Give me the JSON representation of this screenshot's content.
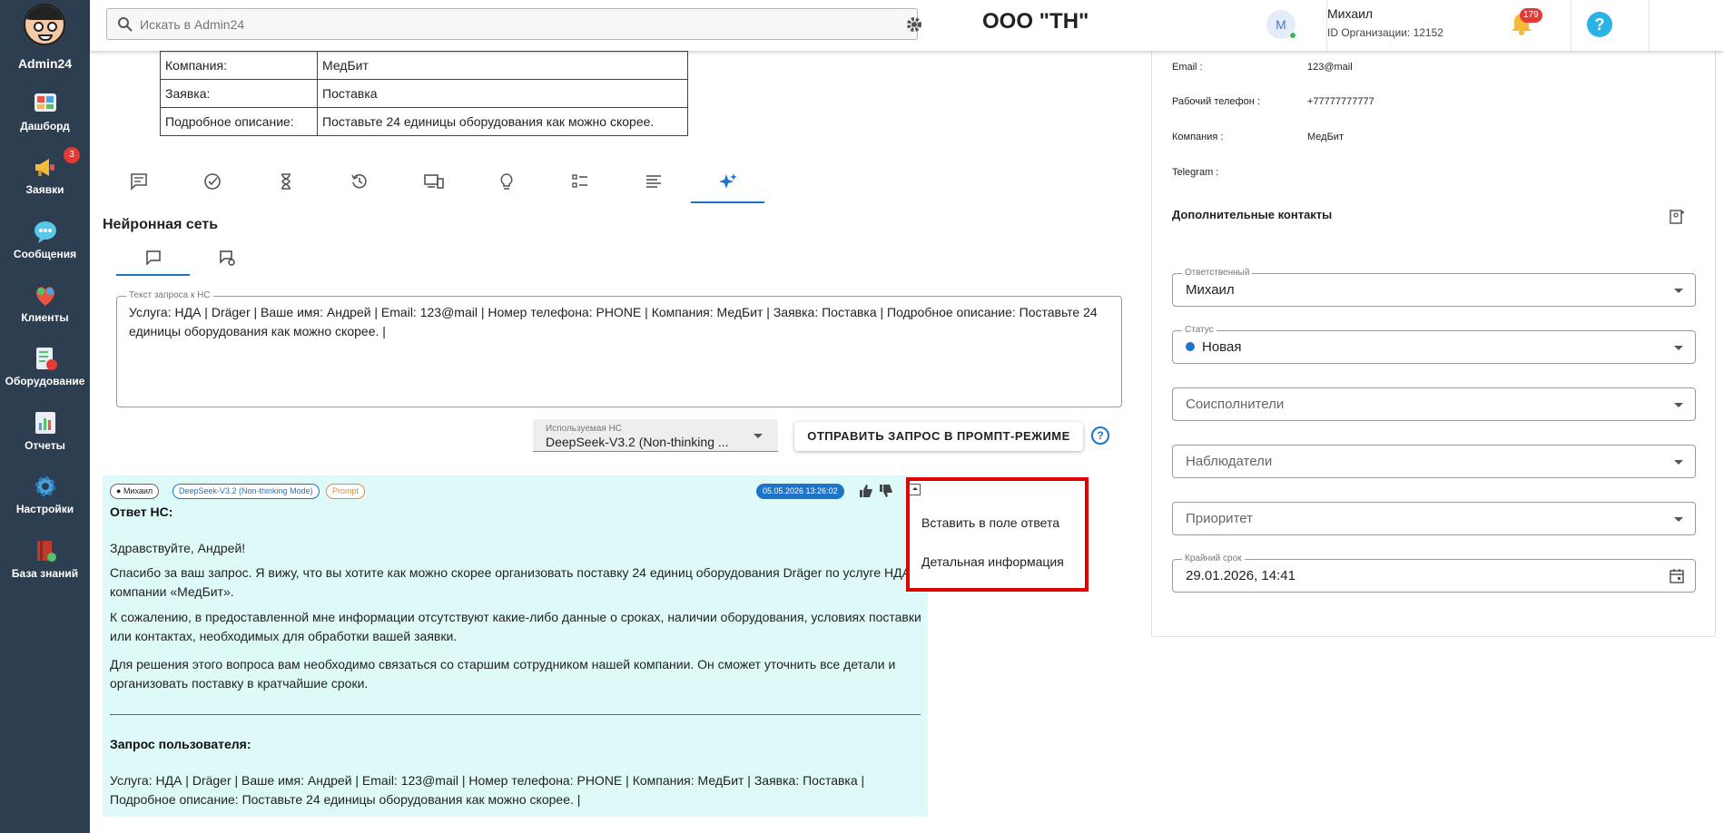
{
  "app": {
    "name": "Admin24"
  },
  "sidebar": {
    "items": [
      {
        "label": "Дашборд",
        "icon": "dashboard-icon"
      },
      {
        "label": "Заявки",
        "icon": "megaphone-icon",
        "badge": "3"
      },
      {
        "label": "Сообщения",
        "icon": "chat-icon"
      },
      {
        "label": "Клиенты",
        "icon": "clients-icon"
      },
      {
        "label": "Оборудование",
        "icon": "equipment-icon"
      },
      {
        "label": "Отчеты",
        "icon": "reports-icon"
      },
      {
        "label": "Настройки",
        "icon": "gear-icon"
      },
      {
        "label": "База знаний",
        "icon": "knowledge-icon"
      }
    ]
  },
  "header": {
    "search_placeholder": "Искать в Admin24",
    "org_title": "ООО \"ТН\"",
    "avatar_letter": "М",
    "user_name": "Михаил",
    "org_id": "ID Организации: 12152",
    "notifications": "179",
    "help": "?"
  },
  "info_table": {
    "rows": [
      {
        "key": "Компания:",
        "value": "МедБит"
      },
      {
        "key": "Заявка:",
        "value": "Поставка"
      },
      {
        "key": "Подробное описание:",
        "value": "Поставьте 24 единицы оборудования как можно скорее."
      }
    ]
  },
  "neural": {
    "title": "Нейронная сеть",
    "prompt_label": "Текст запроса к НС",
    "prompt_text": "Услуга: НДА | Dräger | Ваше имя: Андрей | Email: 123@mail | Номер телефона: PHONE | Компания: МедБит | Заявка: Поставка | Подробное описание: Поставьте 24 единицы оборудования как можно скорее. |",
    "model_label": "Используемая НС",
    "model_value": "DeepSeek-V3.2 (Non-thinking ...",
    "send_button": "ОТПРАВИТЬ ЗАПРОС В ПРОМПТ-РЕЖИМЕ",
    "help": "?"
  },
  "answer": {
    "chip_user": "Михаил",
    "chip_model": "DeepSeek-V3.2 (Non-thinking Mode)",
    "chip_prompt": "Prompt",
    "date": "05.05.2026 13:26:02",
    "heading": "Ответ НС:",
    "greeting": "Здравствуйте, Андрей!",
    "p1": "Спасибо за ваш запрос. Я вижу, что вы хотите как можно скорее организовать поставку 24 единиц оборудования Dräger по услуге НДА от компании «МедБит».",
    "p2": "К сожалению, в предоставленной мне информации отсутствуют какие-либо данные о сроках, наличии оборудования, условиях поставки или контактах, необходимых для обработки вашей заявки.",
    "p3": "Для решения этого вопроса вам необходимо связаться со старшим сотрудником нашей компании. Он сможет уточнить все детали и организовать поставку в кратчайшие сроки.",
    "user_request_heading": "Запрос пользователя:",
    "user_request_text": "Услуга: НДА | Dräger | Ваше имя: Андрей | Email: 123@mail | Номер телефона: PHONE | Компания: МедБит | Заявка: Поставка | Подробное описание: Поставьте 24 единицы оборудования как можно скорее. |"
  },
  "context_menu": {
    "items": [
      "Вставить в поле ответа",
      "Детальная информация"
    ]
  },
  "right_panel": {
    "contacts": [
      {
        "label": "Email :",
        "value": "123@mail"
      },
      {
        "label": "Рабочий телефон :",
        "value": "+77777777777"
      },
      {
        "label": "Компания :",
        "value": "МедБит"
      },
      {
        "label": "Telegram :",
        "value": ""
      }
    ],
    "additional_title": "Дополнительные контакты",
    "responsible_label": "Ответственный",
    "responsible_value": "Михаил",
    "status_label": "Статус",
    "status_value": "Новая",
    "coexecutors_placeholder": "Соисполнители",
    "observers_placeholder": "Наблюдатели",
    "priority_placeholder": "Приоритет",
    "deadline_label": "Крайний срок",
    "deadline_value": "29.01.2026, 14:41"
  },
  "colors": {
    "sidebar": "#2d3e50",
    "accent": "#1e74c9",
    "answer_bg": "#ddfaf9",
    "highlight": "#e10000",
    "badge": "#e53935"
  }
}
